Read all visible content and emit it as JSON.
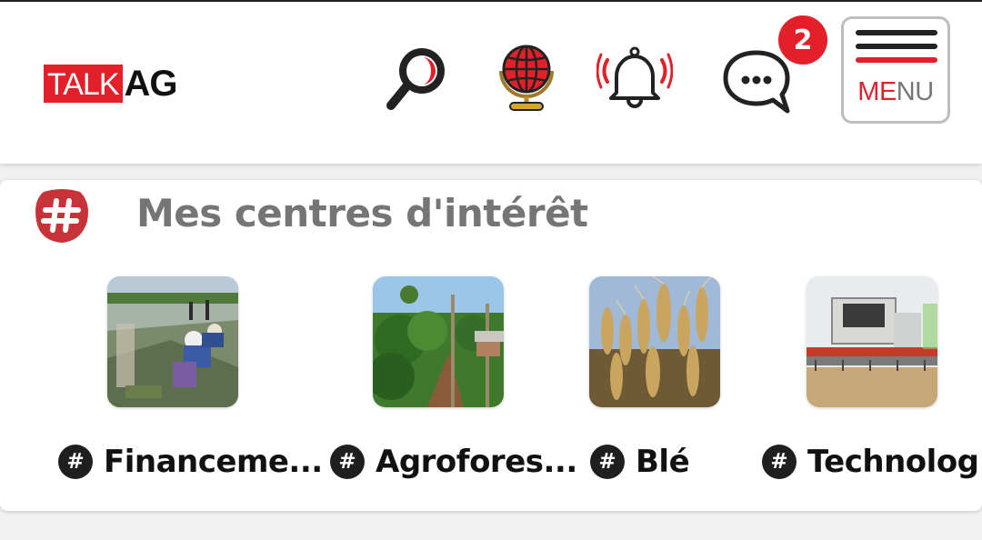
{
  "header": {
    "logo": {
      "part1": "TALK",
      "part2": "AG"
    },
    "icons": [
      "search-icon",
      "globe-icon",
      "notification-bell-icon",
      "chat-bubble-icon"
    ],
    "messages_badge": "2",
    "menu": {
      "label_red": "ME",
      "label_gray": "NU"
    }
  },
  "colors": {
    "accent": "#e3202a",
    "title_gray": "#757575",
    "dark": "#1f1f1f"
  },
  "interests_card": {
    "icon": "hashtag-icon",
    "title": "Mes centres d'intérêt",
    "items": [
      {
        "hash": "#",
        "name": "Financeme...",
        "image": "rice-field-workers"
      },
      {
        "hash": "#",
        "name": "Agrofores...",
        "image": "agroforestry-trees"
      },
      {
        "hash": "#",
        "name": "Blé",
        "image": "wheat-ears"
      },
      {
        "hash": "#",
        "name": "Technolog...",
        "image": "combine-harvester"
      }
    ]
  }
}
